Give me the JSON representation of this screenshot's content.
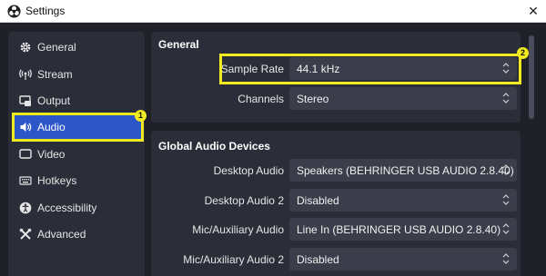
{
  "window": {
    "title": "Settings",
    "close_glyph": "✕"
  },
  "colors": {
    "accent": "#2d57c8",
    "highlight": "#f0ea1e",
    "panel": "#2b2e38",
    "field": "#3b3e4a"
  },
  "sidebar": {
    "items": [
      {
        "label": "General",
        "icon": "gear-icon"
      },
      {
        "label": "Stream",
        "icon": "broadcast-icon"
      },
      {
        "label": "Output",
        "icon": "output-icon"
      },
      {
        "label": "Audio",
        "icon": "speaker-icon",
        "selected": true
      },
      {
        "label": "Video",
        "icon": "monitor-icon"
      },
      {
        "label": "Hotkeys",
        "icon": "keyboard-icon"
      },
      {
        "label": "Accessibility",
        "icon": "accessibility-icon"
      },
      {
        "label": "Advanced",
        "icon": "tools-icon"
      }
    ]
  },
  "badges": {
    "one": "1",
    "two": "2"
  },
  "general": {
    "title": "General",
    "sample_rate": {
      "label": "Sample Rate",
      "value": "44.1 kHz"
    },
    "channels": {
      "label": "Channels",
      "value": "Stereo"
    }
  },
  "global_audio": {
    "title": "Global Audio Devices",
    "desktop_audio": {
      "label": "Desktop Audio",
      "value": "Speakers (BEHRINGER USB AUDIO 2.8.40)"
    },
    "desktop_audio_2": {
      "label": "Desktop Audio 2",
      "value": "Disabled"
    },
    "mic_aux": {
      "label": "Mic/Auxiliary Audio",
      "value": "Line In (BEHRINGER USB AUDIO 2.8.40)"
    },
    "mic_aux_2": {
      "label": "Mic/Auxiliary Audio 2",
      "value": "Disabled"
    }
  }
}
